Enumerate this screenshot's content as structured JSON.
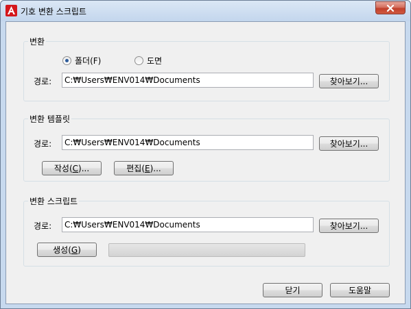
{
  "window": {
    "title": "기호 변환 스크립트"
  },
  "convert_group": {
    "title": "변환",
    "radio_folder": "폴더(F)",
    "radio_drawing": "도면",
    "selected": "folder",
    "path_label": "경로:",
    "path_value": "C:₩Users₩ENV014₩Documents",
    "browse_label": "찾아보기..."
  },
  "template_group": {
    "title": "변환 템플릿",
    "path_label": "경로:",
    "path_value": "C:₩Users₩ENV014₩Documents",
    "browse_label": "찾아보기...",
    "create_prefix": "작성(",
    "create_key": "C",
    "create_suffix": ")...",
    "edit_prefix": "편집(",
    "edit_key": "E",
    "edit_suffix": ")..."
  },
  "script_group": {
    "title": "변환 스크립트",
    "path_label": "경로:",
    "path_value": "C:₩Users₩ENV014₩Documents",
    "browse_label": "찾아보기...",
    "generate_prefix": "생성(",
    "generate_key": "G",
    "generate_suffix": ")",
    "progress": 0
  },
  "footer": {
    "close_label": "닫기",
    "help_label": "도움말"
  },
  "colors": {
    "close_button": "#c1402c",
    "radio_dot": "#2d5b9a",
    "app_icon": "#d4171c"
  }
}
